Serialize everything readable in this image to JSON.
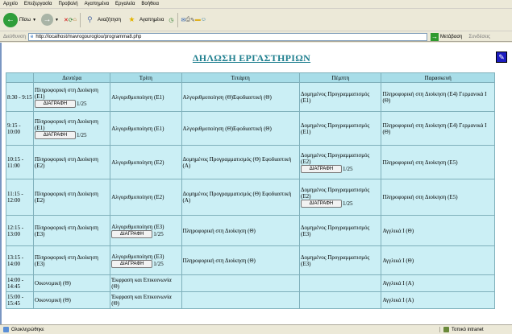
{
  "menu": [
    "Αρχείο",
    "Επεξεργασία",
    "Προβολή",
    "Αγαπημένα",
    "Εργαλεία",
    "Βοήθεια"
  ],
  "toolbar": {
    "back": "Πίσω",
    "search": "Αναζήτηση",
    "favorites": "Αγαπημένα"
  },
  "address": {
    "label": "Διεύθυνση",
    "url": "http://localhost/mavrogouroglou/programma8.php",
    "go": "Μετάβαση",
    "links": "Συνδέσεις"
  },
  "page": {
    "title": "ΔΗΛΩΣΗ ΕΡΓΑΣΤΗΡΙΩΝ",
    "edit_icon": "edit-icon"
  },
  "schedule": {
    "days": [
      "Δευτέρα",
      "Τρίτη",
      "Τετάρτη",
      "Πέμπτη",
      "Παρασκευή"
    ],
    "delete_label": "ΔΙΑΓΡΑΦΗ",
    "rows": [
      {
        "time": "8:30 - 9:15",
        "mon": "Πληροφορική στη Διοίκηση (Ε1)",
        "mon_count": "1/25",
        "tue": "Αλγοριθμοποίηση (Ε1)",
        "wed": "Αλγοριθμοποίηση (Θ)Εφοδιαστική (Θ)",
        "thu": "Δομημένος Προγραμματισμός (Ε1)",
        "fri": "Πληροφορική στη Διοίκηση (Ε4) Γερμανικά Ι (Θ)"
      },
      {
        "time": "9:15 - 10:00",
        "mon": "Πληροφορική στη Διοίκηση (Ε1)",
        "mon_count": "1/25",
        "tue": "Αλγοριθμοποίηση (Ε1)",
        "wed": "Αλγοριθμοποίηση (Θ)Εφοδιαστική (Θ)",
        "thu": "Δομημένος Προγραμματισμός (Ε1)",
        "fri": "Πληροφορική στη Διοίκηση (Ε4) Γερμανικά Ι (Θ)"
      },
      {
        "time": "10:15 - 11:00",
        "mon": "Πληροφορική στη Διοίκηση (Ε2)",
        "tue": "Αλγοριθμοποίηση (Ε2)",
        "wed": "Δομημένος Προγραμματισμός (Θ) Εφοδιαστική (Α)",
        "thu": "Δομημένος Προγραμματισμός (Ε2)",
        "thu_count": "1/25",
        "fri": "Πληροφορική στη Διοίκηση (Ε5)"
      },
      {
        "time": "11:15 - 12:00",
        "mon": "Πληροφορική στη Διοίκηση (Ε2)",
        "tue": "Αλγοριθμοποίηση (Ε2)",
        "wed": "Δομημένος Προγραμματισμός (Θ) Εφοδιαστική (Α)",
        "thu": "Δομημένος Προγραμματισμός (Ε2)",
        "thu_count": "1/25",
        "fri": "Πληροφορική στη Διοίκηση (Ε5)"
      },
      {
        "time": "12:15 - 13:00",
        "mon": "Πληροφορική στη Διοίκηση (Ε3)",
        "tue": "Αλγοριθμοποίηση (Ε3)",
        "tue_count": "1/25",
        "wed": "Πληροφορική στη Διοίκηση (Θ)",
        "thu": "Δομημένος Προγραμματισμός (Ε3)",
        "fri": "Αγγλικά Ι (Θ)"
      },
      {
        "time": "13:15 - 14:00",
        "mon": "Πληροφορική στη Διοίκηση (Ε3)",
        "tue": "Αλγοριθμοποίηση (Ε3)",
        "tue_count": "1/25",
        "wed": "Πληροφορική στη Διοίκηση (Θ)",
        "thu": "Δομημένος Προγραμματισμός (Ε3)",
        "fri": "Αγγλικά Ι (Θ)"
      },
      {
        "time": "14:00 - 14:45",
        "mon": "Οικονομική (Θ)",
        "tue": "Έκφραση και Επικοινωνία (Θ)",
        "wed": "",
        "thu": "",
        "fri": "Αγγλικά Ι (Α)"
      },
      {
        "time": "15:00 - 15:45",
        "mon": "Οικονομική (Θ)",
        "tue": "Έκφραση και Επικοινωνία (Θ)",
        "wed": "",
        "thu": "",
        "fri": "Αγγλικά Ι (Α)"
      }
    ]
  },
  "status": {
    "done": "Ολοκληρώθηκε",
    "zone": "Τοπικό intranet"
  }
}
